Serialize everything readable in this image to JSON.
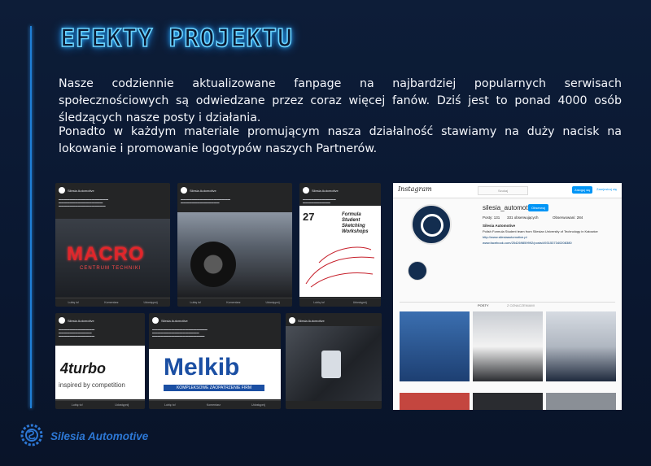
{
  "slide": {
    "title": "EFEKTY PROJEKTU",
    "paragraph1": "Nasze codziennie aktualizowane fanpage na najbardziej popularnych serwisach społecznościowych są odwiedzane przez coraz więcej fanów. Dziś jest to ponad 4000 osób śledzących nasze posty i działania.",
    "paragraph2": "Ponadto w każdym materiale promującym nasza działalność stawiamy na duży nacisk na lokowanie i promowanie logotypów naszych Partnerów.",
    "brand": "Silesia Automotive"
  },
  "posts": {
    "page_name": "Silesia Automotive",
    "like": "Lubię to!",
    "comment": "Komentarz",
    "share": "Udostępnij",
    "macro_logo": "MACRO",
    "macro_sub": "CENTRUM TECHNIKI",
    "turbo_logo": "4turbo",
    "turbo_sub": "inspired by competition",
    "melkib_logo": "Melkib",
    "melkib_sub": "KOMPLEKSOWE ZAOPATRZENIE FIRM",
    "workshop_title": "Formula Student Sketching Workshops",
    "workshop_num": "27"
  },
  "instagram": {
    "wordmark": "Instagram",
    "search_placeholder": "Szukaj",
    "login": "Zaloguj się",
    "signup": "Zarejestruj się",
    "username": "silesia_automotive",
    "follow": "Obserwuj",
    "posts": "Posty: 131",
    "followers": "331 obserwujących",
    "following": "Obserwowani: 284",
    "full_name": "Silesia Automotive",
    "bio": "Polish Formula Student team from Silesian University of Technology in Katowice",
    "link1": "http://www.silesiaautomotive.pl",
    "link2": "www.facebook.com/254269859992/posts/4931537340208380",
    "tab_posts": "POSTY",
    "tab_tagged": "Z OZNACZENIAMI"
  },
  "colors": {
    "accent": "#2d78d6",
    "neon": "#6ad2ff",
    "background": "#0b1a33"
  }
}
